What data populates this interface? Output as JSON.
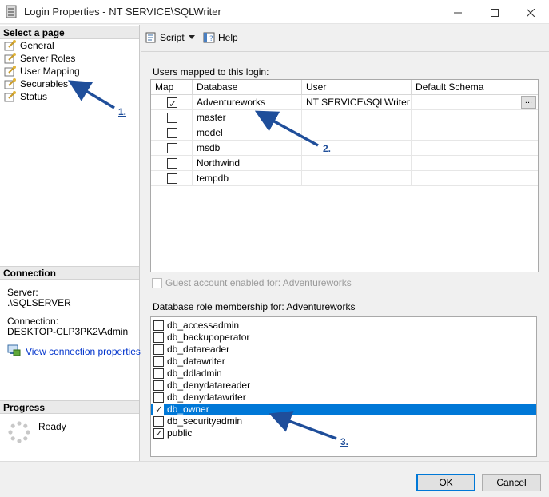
{
  "window": {
    "title": "Login Properties - NT SERVICE\\SQLWriter",
    "minimize_icon": "minimize-icon",
    "maximize_icon": "maximize-icon",
    "close_icon": "close-icon"
  },
  "left_panel": {
    "select_page_header": "Select a page",
    "pages": [
      {
        "label": "General",
        "icon": "page-wrench-icon"
      },
      {
        "label": "Server Roles",
        "icon": "page-wrench-icon"
      },
      {
        "label": "User Mapping",
        "icon": "page-wrench-icon"
      },
      {
        "label": "Securables",
        "icon": "page-wrench-icon"
      },
      {
        "label": "Status",
        "icon": "page-wrench-icon"
      }
    ],
    "connection_header": "Connection",
    "server_label": "Server:",
    "server_value": ".\\SQLSERVER",
    "connection_label": "Connection:",
    "connection_value": "DESKTOP-CLP3PK2\\Admin",
    "view_connection_link": "View connection properties",
    "progress_header": "Progress",
    "progress_status": "Ready"
  },
  "toolbar": {
    "script_label": "Script",
    "help_label": "Help"
  },
  "users_mapped": {
    "label": "Users mapped to this login:",
    "columns": [
      "Map",
      "Database",
      "User",
      "Default Schema"
    ],
    "rows": [
      {
        "map": true,
        "database": "Adventureworks",
        "user": "NT SERVICE\\SQLWriter",
        "schema": ""
      },
      {
        "map": false,
        "database": "master",
        "user": "",
        "schema": ""
      },
      {
        "map": false,
        "database": "model",
        "user": "",
        "schema": ""
      },
      {
        "map": false,
        "database": "msdb",
        "user": "",
        "schema": ""
      },
      {
        "map": false,
        "database": "Northwind",
        "user": "",
        "schema": ""
      },
      {
        "map": false,
        "database": "tempdb",
        "user": "",
        "schema": ""
      }
    ],
    "ellipsis_label": "..."
  },
  "guest": {
    "label": "Guest account enabled for: Adventureworks",
    "checked": false
  },
  "roles": {
    "label": "Database role membership for: Adventureworks",
    "items": [
      {
        "name": "db_accessadmin",
        "checked": false,
        "selected": false
      },
      {
        "name": "db_backupoperator",
        "checked": false,
        "selected": false
      },
      {
        "name": "db_datareader",
        "checked": false,
        "selected": false
      },
      {
        "name": "db_datawriter",
        "checked": false,
        "selected": false
      },
      {
        "name": "db_ddladmin",
        "checked": false,
        "selected": false
      },
      {
        "name": "db_denydatareader",
        "checked": false,
        "selected": false
      },
      {
        "name": "db_denydatawriter",
        "checked": false,
        "selected": false
      },
      {
        "name": "db_owner",
        "checked": true,
        "selected": true
      },
      {
        "name": "db_securityadmin",
        "checked": false,
        "selected": false
      },
      {
        "name": "public",
        "checked": true,
        "selected": false
      }
    ]
  },
  "buttons": {
    "ok": "OK",
    "cancel": "Cancel"
  },
  "annotations": {
    "one": "1.",
    "two": "2.",
    "three": "3.",
    "color": "#1f4e9a"
  },
  "colors": {
    "selection": "#0078d7",
    "link": "#0033cc"
  }
}
